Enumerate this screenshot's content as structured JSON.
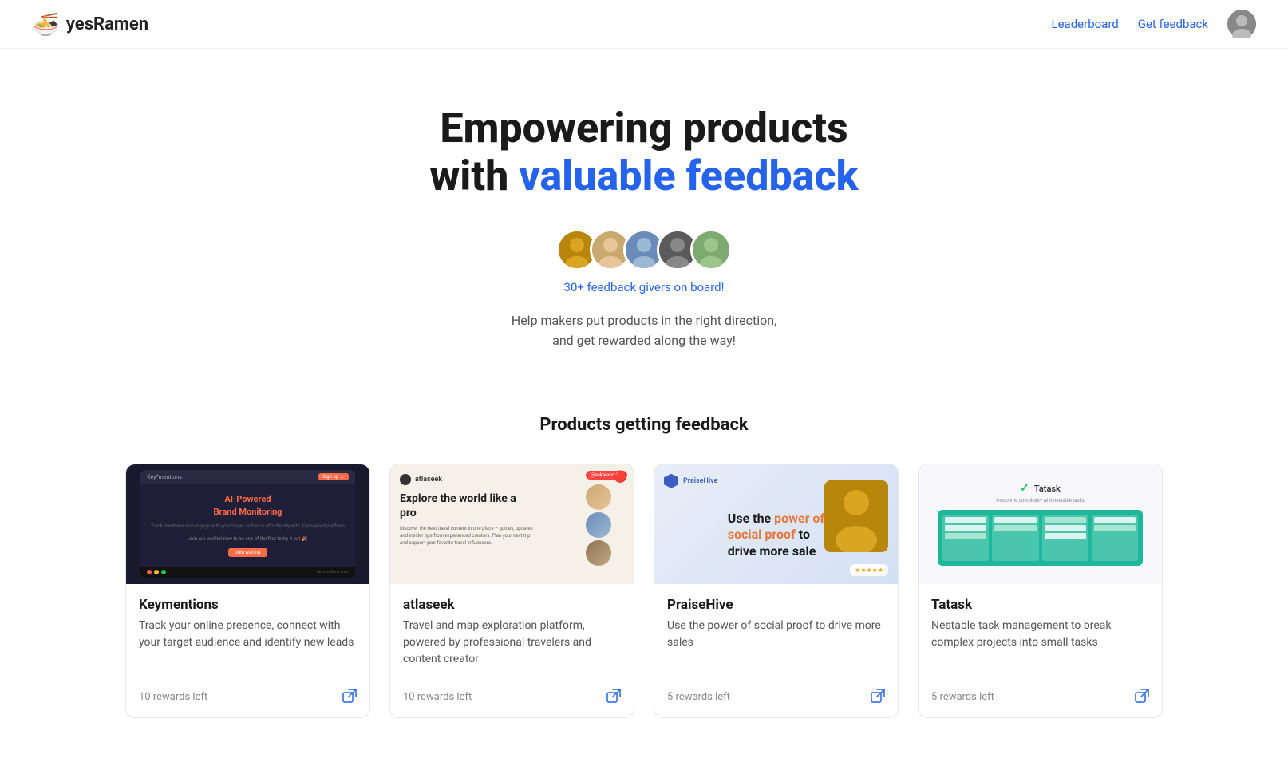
{
  "nav": {
    "logo_icon": "🍜",
    "logo_text": "yesRamen",
    "links": [
      {
        "id": "leaderboard",
        "label": "Leaderboard"
      },
      {
        "id": "get-feedback",
        "label": "Get feedback"
      }
    ],
    "avatar_letter": "👤"
  },
  "hero": {
    "title_line1": "Empowering products",
    "title_line2_normal": "with ",
    "title_line2_highlight": "valuable feedback",
    "avatars": [
      {
        "id": 1,
        "emoji": "🧑‍🦱"
      },
      {
        "id": 2,
        "emoji": "👩"
      },
      {
        "id": 3,
        "emoji": "🧔"
      },
      {
        "id": 4,
        "emoji": "👨"
      },
      {
        "id": 5,
        "emoji": "🧑"
      }
    ],
    "feedback_count": "30+ feedback givers on board!",
    "subtext_line1": "Help makers put products in the right direction,",
    "subtext_line2": "and get rewarded along the way!"
  },
  "products_section": {
    "title": "Products getting feedback",
    "cards": [
      {
        "id": "keymentions",
        "name": "Keymentions",
        "desc": "Track your online presence, connect with your target audience and identify new leads",
        "rewards": "10 rewards left"
      },
      {
        "id": "atlaseek",
        "name": "atlaseek",
        "desc": "Travel and map exploration platform, powered by professional travelers and content creator",
        "rewards": "10 rewards left"
      },
      {
        "id": "praisehive",
        "name": "PraiseHive",
        "desc": "Use the power of social proof to drive more sales",
        "rewards": "5 rewards left"
      },
      {
        "id": "tatask",
        "name": "Tatask",
        "desc": "Nestable task management to break complex projects into small tasks",
        "rewards": "5 rewards left"
      }
    ]
  },
  "icons": {
    "external_link": "⧉"
  }
}
